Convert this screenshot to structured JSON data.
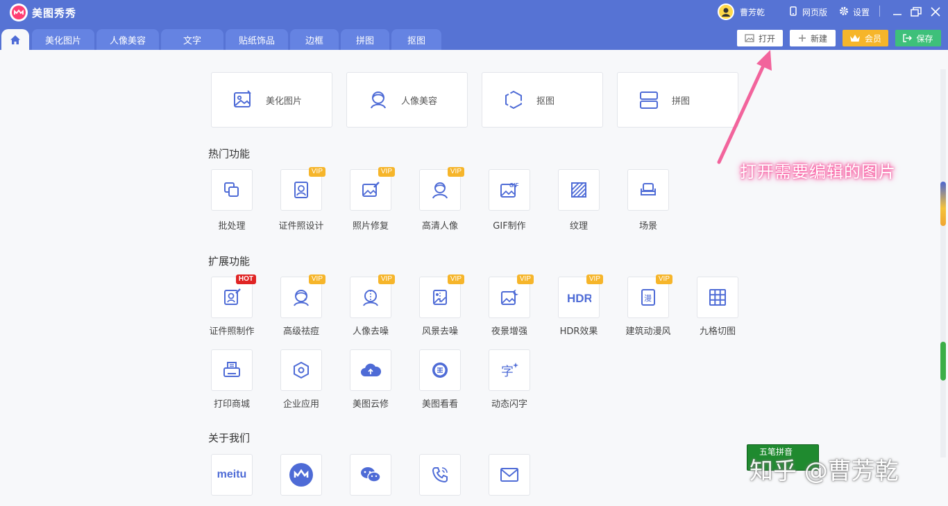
{
  "app": {
    "title": "美图秀秀"
  },
  "user": {
    "name": "曹芳乾"
  },
  "window_controls": {
    "web_version": "网页版",
    "settings": "设置"
  },
  "tabs": [
    {
      "label": "美化图片"
    },
    {
      "label": "人像美容"
    },
    {
      "label": "文字"
    },
    {
      "label": "贴纸饰品"
    },
    {
      "label": "边框"
    },
    {
      "label": "拼图"
    },
    {
      "label": "抠图"
    }
  ],
  "toolbar": {
    "open": "打开",
    "new": "新建",
    "member": "会员",
    "save": "保存"
  },
  "quick_cards": [
    {
      "label": "美化图片",
      "icon": "image-edit-icon"
    },
    {
      "label": "人像美容",
      "icon": "portrait-icon"
    },
    {
      "label": "抠图",
      "icon": "cutout-hexagon-icon"
    },
    {
      "label": "拼图",
      "icon": "collage-icon"
    }
  ],
  "sections": {
    "hot": "热门功能",
    "extended": "扩展功能",
    "about": "关于我们"
  },
  "hot_items": [
    {
      "label": "批处理",
      "badge": ""
    },
    {
      "label": "证件照设计",
      "badge": "VIP"
    },
    {
      "label": "照片修复",
      "badge": "VIP"
    },
    {
      "label": "高清人像",
      "badge": "VIP"
    },
    {
      "label": "GIF制作",
      "badge": ""
    },
    {
      "label": "纹理",
      "badge": ""
    },
    {
      "label": "场景",
      "badge": ""
    }
  ],
  "ext_items_row1": [
    {
      "label": "证件照制作",
      "badge": "HOT"
    },
    {
      "label": "高级祛痘",
      "badge": "VIP"
    },
    {
      "label": "人像去噪",
      "badge": "VIP"
    },
    {
      "label": "风景去噪",
      "badge": "VIP"
    },
    {
      "label": "夜景增强",
      "badge": "VIP"
    },
    {
      "label": "HDR效果",
      "badge": "VIP"
    },
    {
      "label": "建筑动漫风",
      "badge": "VIP"
    },
    {
      "label": "九格切图",
      "badge": ""
    }
  ],
  "ext_items_row2": [
    {
      "label": "打印商城"
    },
    {
      "label": "企业应用"
    },
    {
      "label": "美图云修"
    },
    {
      "label": "美图看看"
    },
    {
      "label": "动态闪字"
    }
  ],
  "about_items": [
    {
      "text": "meitu"
    }
  ],
  "icon_text": {
    "gif": "GIF",
    "hdr": "HDR",
    "manga": "漫",
    "font": "字"
  },
  "annotation": "打开需要编辑的图片",
  "ime": "五笔拼音",
  "watermark": "知乎 @曹芳乾",
  "colors": {
    "topbar": "#5673d4",
    "accent": "#4e6bd6",
    "vip": "#f6b52a",
    "hot": "#e02424",
    "member": "#f6b52a",
    "save": "#3ec07a",
    "annotation_glow": "#ff5aa0"
  }
}
